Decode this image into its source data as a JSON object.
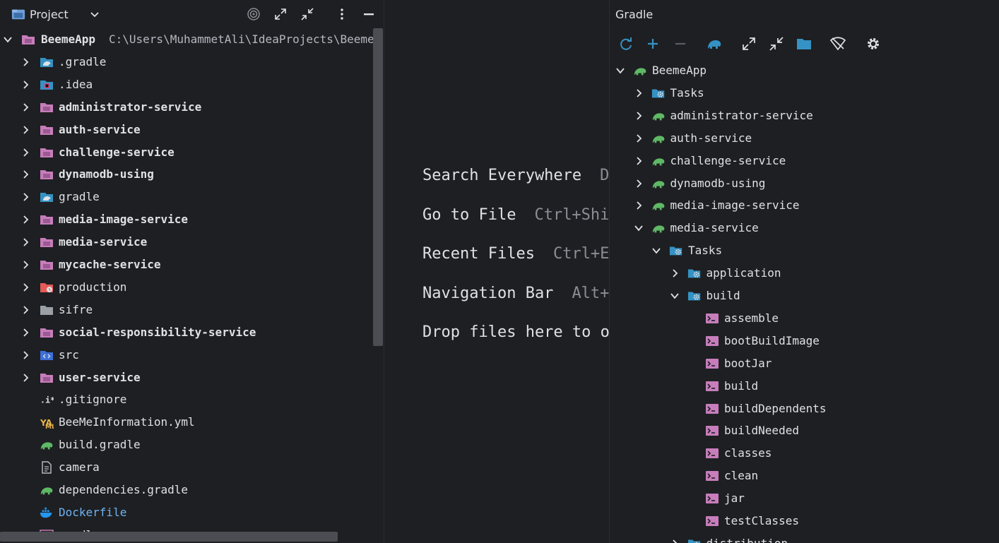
{
  "project": {
    "title": "Project",
    "root": {
      "name": "BeemeApp",
      "path": "C:\\Users\\MuhammetAli\\IdeaProjects\\BeemeA"
    },
    "items": [
      {
        "label": ".gradle",
        "icon": "gradle-folder-icon",
        "bold": false,
        "expandable": true
      },
      {
        "label": ".idea",
        "icon": "idea-folder-icon",
        "bold": false,
        "expandable": true
      },
      {
        "label": "administrator-service",
        "icon": "module-folder-icon",
        "bold": true,
        "expandable": true
      },
      {
        "label": "auth-service",
        "icon": "module-folder-icon",
        "bold": true,
        "expandable": true
      },
      {
        "label": "challenge-service",
        "icon": "module-folder-icon",
        "bold": true,
        "expandable": true
      },
      {
        "label": "dynamodb-using",
        "icon": "module-folder-icon",
        "bold": true,
        "expandable": true
      },
      {
        "label": "gradle",
        "icon": "gradle-folder-icon",
        "bold": false,
        "expandable": true
      },
      {
        "label": "media-image-service",
        "icon": "module-folder-icon",
        "bold": true,
        "expandable": true
      },
      {
        "label": "media-service",
        "icon": "module-folder-icon",
        "bold": true,
        "expandable": true
      },
      {
        "label": "mycache-service",
        "icon": "module-folder-icon",
        "bold": true,
        "expandable": true
      },
      {
        "label": "production",
        "icon": "excluded-folder-icon",
        "bold": false,
        "expandable": true
      },
      {
        "label": "sifre",
        "icon": "folder-icon",
        "bold": false,
        "expandable": true
      },
      {
        "label": "social-responsibility-service",
        "icon": "module-folder-icon",
        "bold": true,
        "expandable": true
      },
      {
        "label": "src",
        "icon": "source-folder-icon",
        "bold": false,
        "expandable": true
      },
      {
        "label": "user-service",
        "icon": "module-folder-icon",
        "bold": true,
        "expandable": true
      },
      {
        "label": ".gitignore",
        "icon": "ignore-file-icon",
        "bold": false,
        "expandable": false
      },
      {
        "label": "BeeMeInformation.yml",
        "icon": "yaml-file-icon",
        "bold": false,
        "expandable": false
      },
      {
        "label": "build.gradle",
        "icon": "gradle-file-icon",
        "bold": false,
        "expandable": false
      },
      {
        "label": "camera",
        "icon": "text-file-icon",
        "bold": false,
        "expandable": false
      },
      {
        "label": "dependencies.gradle",
        "icon": "gradle-file-icon",
        "bold": false,
        "expandable": false
      },
      {
        "label": "Dockerfile",
        "icon": "docker-file-icon",
        "bold": false,
        "expandable": false,
        "color": "#6fb3f2"
      },
      {
        "label": "gradlew",
        "icon": "shell-file-icon",
        "bold": false,
        "expandable": false
      }
    ]
  },
  "editor": {
    "hints": [
      {
        "action": "Search Everywhere",
        "shortcut": "Double Shift"
      },
      {
        "action": "Go to File",
        "shortcut": "Ctrl+Shift+N"
      },
      {
        "action": "Recent Files",
        "shortcut": "Ctrl+E"
      },
      {
        "action": "Navigation Bar",
        "shortcut": "Alt+Home"
      },
      {
        "action": "Drop files here to open them",
        "shortcut": ""
      }
    ]
  },
  "gradle": {
    "title": "Gradle",
    "tree": [
      {
        "label": "BeemeApp",
        "level": 0,
        "icon": "gradle-elephant-icon",
        "state": "expanded"
      },
      {
        "label": "Tasks",
        "level": 1,
        "icon": "tasks-folder-icon",
        "state": "collapsed"
      },
      {
        "label": "administrator-service",
        "level": 1,
        "icon": "gradle-elephant-icon",
        "state": "collapsed"
      },
      {
        "label": "auth-service",
        "level": 1,
        "icon": "gradle-elephant-icon",
        "state": "collapsed"
      },
      {
        "label": "challenge-service",
        "level": 1,
        "icon": "gradle-elephant-icon",
        "state": "collapsed"
      },
      {
        "label": "dynamodb-using",
        "level": 1,
        "icon": "gradle-elephant-icon",
        "state": "collapsed"
      },
      {
        "label": "media-image-service",
        "level": 1,
        "icon": "gradle-elephant-icon",
        "state": "collapsed"
      },
      {
        "label": "media-service",
        "level": 1,
        "icon": "gradle-elephant-icon",
        "state": "expanded"
      },
      {
        "label": "Tasks",
        "level": 2,
        "icon": "tasks-folder-icon",
        "state": "expanded"
      },
      {
        "label": "application",
        "level": 3,
        "icon": "tasks-folder-icon",
        "state": "collapsed"
      },
      {
        "label": "build",
        "level": 3,
        "icon": "tasks-folder-icon",
        "state": "expanded"
      },
      {
        "label": "assemble",
        "level": 4,
        "icon": "task-icon",
        "state": "leaf"
      },
      {
        "label": "bootBuildImage",
        "level": 4,
        "icon": "task-icon",
        "state": "leaf"
      },
      {
        "label": "bootJar",
        "level": 4,
        "icon": "task-icon",
        "state": "leaf"
      },
      {
        "label": "build",
        "level": 4,
        "icon": "task-icon",
        "state": "leaf"
      },
      {
        "label": "buildDependents",
        "level": 4,
        "icon": "task-icon",
        "state": "leaf"
      },
      {
        "label": "buildNeeded",
        "level": 4,
        "icon": "task-icon",
        "state": "leaf"
      },
      {
        "label": "classes",
        "level": 4,
        "icon": "task-icon",
        "state": "leaf"
      },
      {
        "label": "clean",
        "level": 4,
        "icon": "task-icon",
        "state": "leaf"
      },
      {
        "label": "jar",
        "level": 4,
        "icon": "task-icon",
        "state": "leaf"
      },
      {
        "label": "testClasses",
        "level": 4,
        "icon": "task-icon",
        "state": "leaf"
      },
      {
        "label": "distribution",
        "level": 3,
        "icon": "tasks-folder-icon",
        "state": "collapsed"
      }
    ]
  },
  "colors": {
    "background": "#1e1f22",
    "text": "#dfe1e5",
    "module_folder": "#c77dbb",
    "gradle_green": "#5fb865",
    "toolbar_blue": "#3592c4",
    "task_pink": "#c77dbb"
  }
}
